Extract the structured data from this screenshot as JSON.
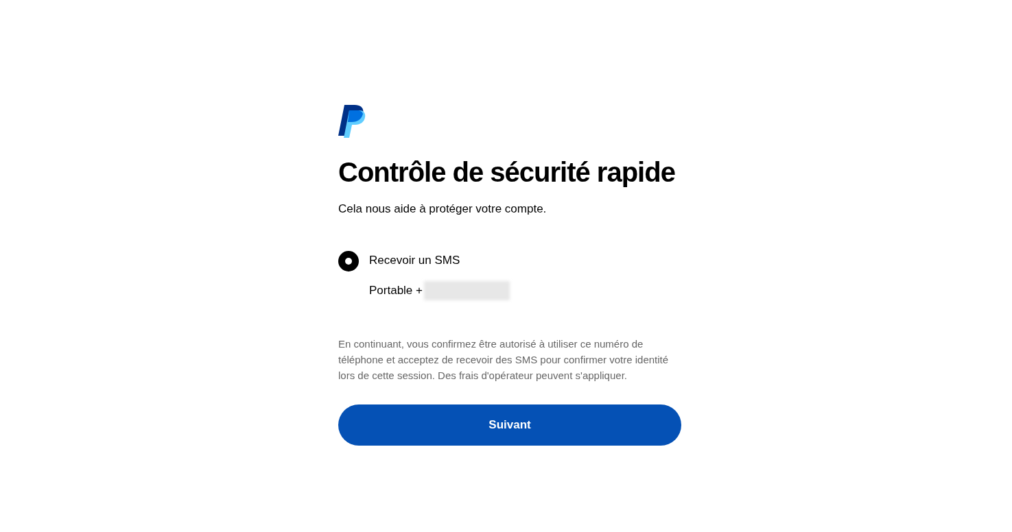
{
  "title": "Contrôle de sécurité rapide",
  "subtitle": "Cela nous aide à protéger votre compte.",
  "options": [
    {
      "label": "Recevoir un SMS",
      "detail": "Portable +",
      "number_hidden": true,
      "selected": true
    }
  ],
  "notice": "En continuant, vous confirmez être autorisé à utiliser ce numéro de téléphone et acceptez de recevoir des SMS pour confirmer votre identité lors de cette session. Des frais d'opérateur peuvent s'appliquer.",
  "button": "Suivant"
}
